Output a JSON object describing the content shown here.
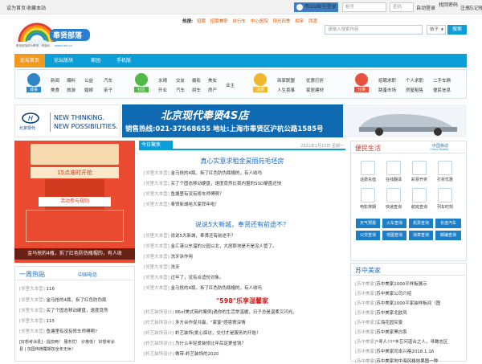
{
  "topbar": {
    "set_home": "设为首页",
    "bookmark": "收藏本站",
    "qq_login": "用QQ帐号登录",
    "account_placeholder": "帐号",
    "password_placeholder": "密码",
    "auto_login": "自动登录",
    "forgot": "找回密码",
    "register": "注册",
    "forgot_account": "忘记帐号"
  },
  "logo": {
    "name": "奉贤部落",
    "slogan": "奉贤部落网为奉贤、闵南网",
    "url": "www.xzfx.cn"
  },
  "hot": {
    "label": "热搜:",
    "items": [
      "招聘",
      "招聘兼职",
      "自行车",
      "中心医院",
      "阳光四季",
      "相亲",
      "西渡"
    ]
  },
  "search": {
    "placeholder": "请输入搜索内容",
    "scope": "帖子",
    "button": "搜索"
  },
  "nav": {
    "items": [
      "论坛首页",
      "论坛版块",
      "家园",
      "手机版"
    ]
  },
  "categories": [
    {
      "name": "城事",
      "links": [
        "新闻",
        "爆料",
        "公益",
        "汽车",
        "美食",
        "旅游",
        "婚嫁",
        "亲子"
      ]
    },
    {
      "name": "社区",
      "links": [
        "水晴",
        "交友",
        "摄影",
        "美女",
        "开业",
        "汽车",
        "拼车",
        "房产",
        "业主"
      ]
    },
    {
      "name": "消费",
      "links": [
        "商家联盟",
        "优惠打折",
        "人生喜事",
        "家居建材"
      ]
    },
    {
      "name": "分类",
      "links": [
        "招聘求职",
        "个人求职",
        "二手车辆",
        "跳蚤市场",
        "房屋租售",
        "便民信息"
      ]
    }
  ],
  "banner": {
    "brand_en1": "NEW THINKING.",
    "brand_en2": "NEW POSSIBILITIES.",
    "brand_cn": "北京现代",
    "shop": "北京现代奉贤4S店",
    "hotline": "销售热线:021-37568655 地址:上海市奉贤区沪杭公路1585号"
  },
  "left_ad": {
    "caption": "金马抢的4瓶，拆了红色防伪瓶帽的，有人收",
    "t1": "15点准时开抢",
    "t2": "活动参与规则"
  },
  "news": {
    "tab": "今日聚焦",
    "date": "2021年2月15日 星期一",
    "headline1": "真心实意求租金昊丽苑毛坯房",
    "group1": [
      {
        "tag": "[邻里大本营]",
        "text": "金马抢的4瓶，拆了红色防伪瓶帽的，有人收吗"
      },
      {
        "tag": "[邻里大本营]",
        "text": "买了个固态移动硬盘，速度竟然比我内置的SSD硬盘还快"
      },
      {
        "tag": "[邻里大本营]",
        "text": "鱼塘里有没有修车师傅啊？"
      },
      {
        "tag": "[邻里大本营]",
        "text": "奉贤新城哈大家拜年啦！"
      }
    ],
    "headline2": "说说5大新城，奉贤还有前途不？",
    "group2": [
      {
        "tag": "[邻里大本营]",
        "text": "说说5大新城，奉贤还有前途不？"
      },
      {
        "tag": "[邻里大本营]",
        "text": "金汇港以东溜的公园以北，大居那块是不是没人管了。"
      },
      {
        "tag": "[邻里大本营]",
        "text": "洗牙涂作用"
      },
      {
        "tag": "[邻里大本营]",
        "text": "洗牙"
      },
      {
        "tag": "[邻里大本营]",
        "text": "过年了，没有合适份对象。"
      },
      {
        "tag": "[邻里大本营]",
        "text": "金马抢的4瓶，拆了红色防伪瓶帽的，有人收吗"
      }
    ],
    "promo": "\"598\"乐享温馨家",
    "group3": [
      {
        "tag": "[岭艺装饰设计]",
        "text": "86㎡美式简约案例|遇你的生活常温暖，日子总是温柔又闪光。"
      },
      {
        "tag": "[岭艺装饰设计]",
        "text": "多方合作促共赢，\"家宴\"感恩寄深情"
      },
      {
        "tag": "[岭艺装饰设计]",
        "text": "岭艺装饰|爱心探访，交付才是服务的开始！"
      },
      {
        "tag": "[岭艺装饰设计]",
        "text": "为什么年轻爱装修比年后定更省钱？"
      },
      {
        "tag": "[岭艺装饰设计]",
        "text": "做带-岭艺装饰的2020"
      }
    ]
  },
  "bmzx": {
    "title": "便民生活",
    "partner": "中国移动",
    "partner_en": "China Mobile",
    "services": [
      "话费充值",
      "在线翻译",
      "彩票开奖",
      "打折优惠",
      "电影排期",
      "快递查询",
      "航班查询",
      "列车时刻"
    ],
    "quick": [
      "天气预报",
      "火车查询",
      "机票查询",
      "长途汽车",
      "公交查询",
      "地图查询",
      "违章查询",
      "邮编查询"
    ]
  },
  "week": {
    "title": "一周热贴",
    "partner": "中国电信",
    "items": [
      {
        "tag": "[邻里大本营]",
        "text": "116"
      },
      {
        "tag": "[邻里大本营]",
        "text": "金马抢的4瓶，拆了红色防伪瓶"
      },
      {
        "tag": "[邻里大本营]",
        "text": "买了个固态移动硬盘，速度竟然"
      },
      {
        "tag": "[邻里大本营]",
        "text": "115"
      },
      {
        "tag": "[邻里大本营]",
        "text": "鱼塘里有没有修车师傅啊?"
      }
    ],
    "extra1": "[好想考涂县] - 提前两！ 服务优！ 价格低！ 好想考涂",
    "extra2": "县 | 加国伟微覆期加全年无休！"
  },
  "szmj": {
    "title": "苏中美家",
    "items": [
      {
        "tag": "[苏中美家]",
        "text": "苏中美家1000平样板展示"
      },
      {
        "tag": "[苏中美家]",
        "text": "苏中美家公司介绍"
      },
      {
        "tag": "[苏中美家]",
        "text": "苏中美家1000平家装样板间（图"
      },
      {
        "tag": "[苏中美家]",
        "text": "苏中美家北欧风"
      },
      {
        "tag": "[苏中美家]",
        "text": "江海花园实景"
      },
      {
        "tag": "[苏中美家]",
        "text": "苏中美家黑白系"
      },
      {
        "tag": "[苏中美家]",
        "text": "*寻人!!!*丰忘问道合之人，寻瞰志区"
      },
      {
        "tag": "[苏中美家]",
        "text": "苏中美家同本兴格2018.1.16"
      },
      {
        "tag": "[苏中美家]",
        "text": "苏中美家地中海风格效果图一种"
      }
    ]
  },
  "colors": {
    "nav": "#0c9ed7",
    "nav_active": "#f09a1d",
    "banner": "#0f6ab2",
    "red": "#d21d1d",
    "link": "#1d6fc5"
  }
}
